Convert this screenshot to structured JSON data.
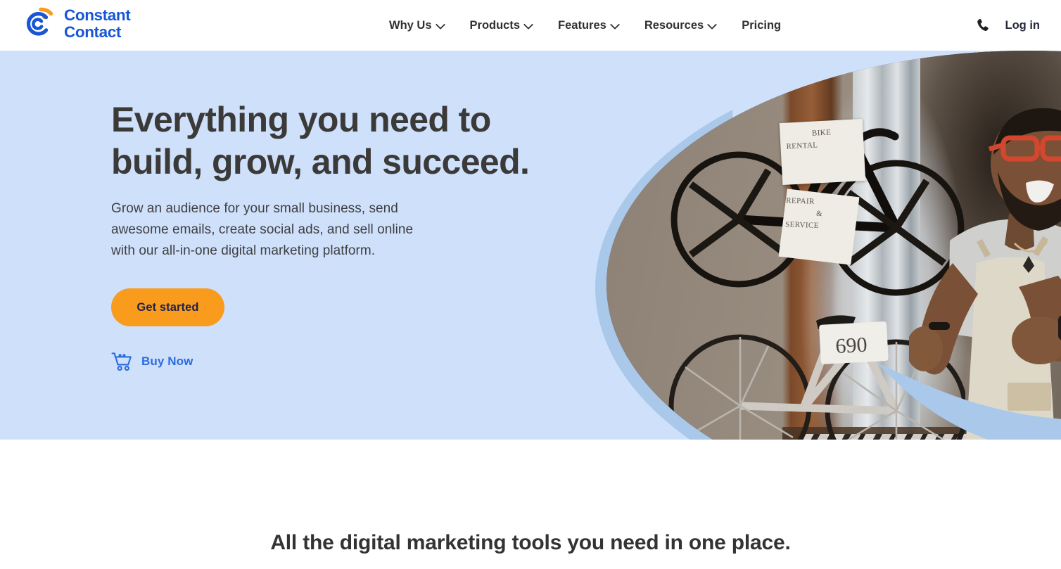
{
  "header": {
    "logo": {
      "icon": "constant-contact-circle-logo",
      "line1": "Constant",
      "line2": "Contact"
    },
    "nav": [
      {
        "label": "Why Us",
        "has_dropdown": true
      },
      {
        "label": "Products",
        "has_dropdown": true
      },
      {
        "label": "Features",
        "has_dropdown": true
      },
      {
        "label": "Resources",
        "has_dropdown": true
      },
      {
        "label": "Pricing",
        "has_dropdown": false
      }
    ],
    "phone_icon": "phone-icon",
    "login_label": "Log in"
  },
  "hero": {
    "title_line1": "Everything you need to",
    "title_line2": "build, grow, and succeed.",
    "sub_line1": "Grow an audience for your small business, send",
    "sub_line2": "awesome emails, create social ads, and sell online",
    "sub_line3": "with our all-in-one digital marketing platform.",
    "cta_label": "Get started",
    "buy_now_label": "Buy Now",
    "buy_now_icon": "shopping-cart-icon",
    "photo": {
      "description": "Smiling bike shop owner with red glasses and apron standing in shop doorway with bicycles",
      "sign1_line1": "BIKE",
      "sign1_line2": "RENTAL",
      "sign2_line1": "REPAIR",
      "sign2_line2": "&",
      "sign2_line3": "SERVICE",
      "bike_tag": "690"
    }
  },
  "below_hero": {
    "heading": "All the digital marketing tools you need in one place."
  },
  "colors": {
    "hero_background": "#cfe0fb",
    "brand_blue": "#1856d6",
    "link_blue": "#2b6cdf",
    "cta_orange": "#f99b1c",
    "cta_text": "#1b2150",
    "heading_dark": "#3b3a38",
    "swoosh_blue": "#a9c8ea"
  }
}
